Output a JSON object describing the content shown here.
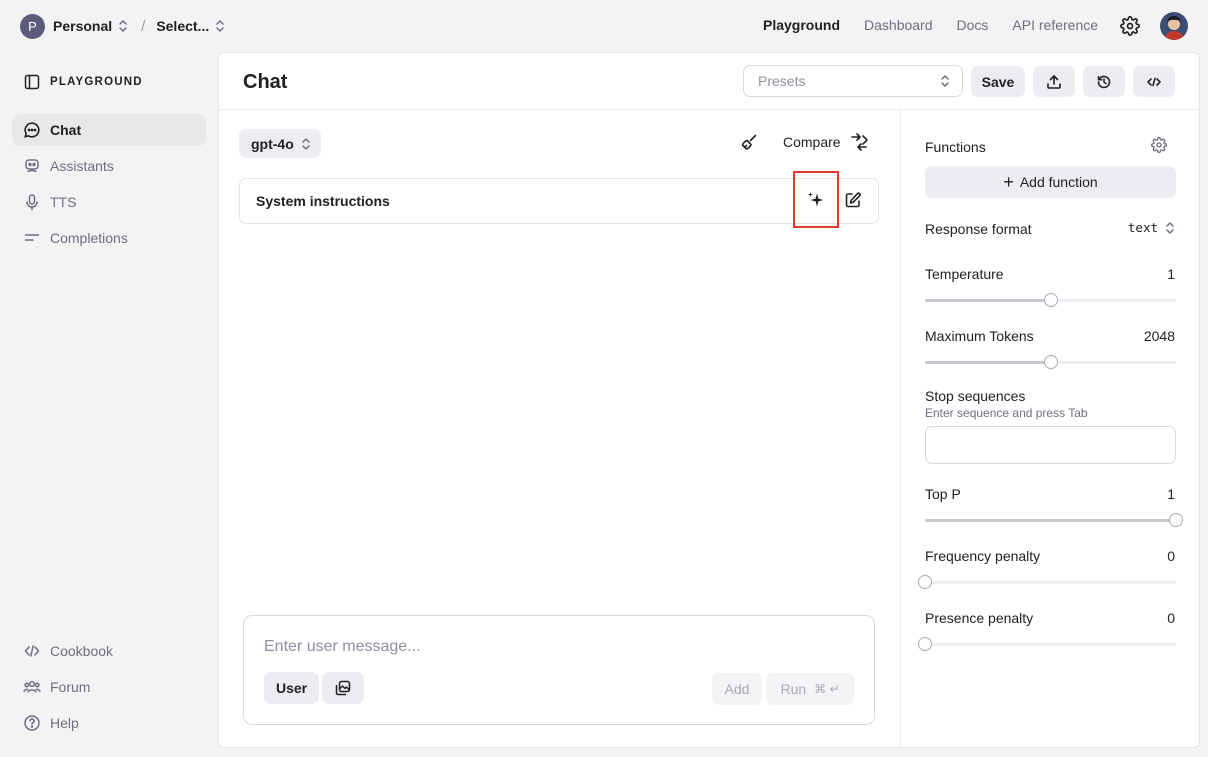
{
  "org": {
    "initial": "P",
    "name": "Personal",
    "project": "Select..."
  },
  "topnav": {
    "playground": "Playground",
    "dashboard": "Dashboard",
    "docs": "Docs",
    "api_reference": "API reference"
  },
  "sidebar": {
    "heading": "PLAYGROUND",
    "items": [
      {
        "label": "Chat",
        "icon": "chat-bubble-icon"
      },
      {
        "label": "Assistants",
        "icon": "robot-icon"
      },
      {
        "label": "TTS",
        "icon": "microphone-icon"
      },
      {
        "label": "Completions",
        "icon": "lines-icon"
      }
    ],
    "bottom_items": [
      {
        "label": "Cookbook",
        "icon": "code-icon"
      },
      {
        "label": "Forum",
        "icon": "people-icon"
      },
      {
        "label": "Help",
        "icon": "question-icon"
      }
    ]
  },
  "header": {
    "title": "Chat",
    "presets_placeholder": "Presets",
    "save_label": "Save"
  },
  "chat": {
    "model": "gpt-4o",
    "compare_label": "Compare",
    "system_label": "System instructions",
    "composer_placeholder": "Enter user message...",
    "role_label": "User",
    "add_label": "Add",
    "run_label": "Run",
    "run_shortcut": "⌘ ↵"
  },
  "settings": {
    "functions_label": "Functions",
    "add_function_label": "Add function",
    "response_format_label": "Response format",
    "response_format_value": "text",
    "temperature": {
      "label": "Temperature",
      "value": "1",
      "fraction": 0.5
    },
    "max_tokens": {
      "label": "Maximum Tokens",
      "value": "2048",
      "fraction": 0.5
    },
    "stop_sequences": {
      "label": "Stop sequences",
      "hint": "Enter sequence and press Tab"
    },
    "top_p": {
      "label": "Top P",
      "value": "1",
      "fraction": 1.0
    },
    "frequency_penalty": {
      "label": "Frequency penalty",
      "value": "0",
      "fraction": 0.0
    },
    "presence_penalty": {
      "label": "Presence penalty",
      "value": "0",
      "fraction": 0.0
    }
  },
  "colors": {
    "highlight_box": "#e03a2a",
    "active_bg": "#e8e8ea"
  }
}
